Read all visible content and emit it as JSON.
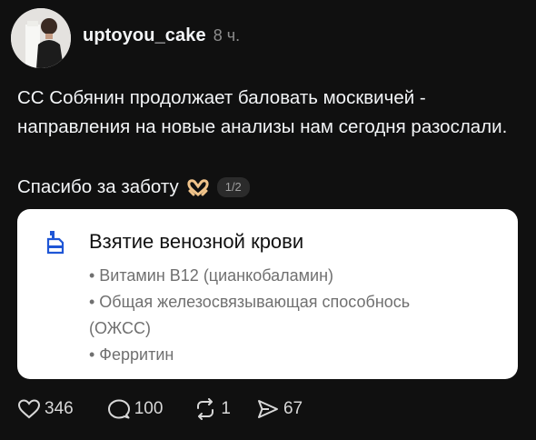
{
  "post": {
    "username": "uptoyou_cake",
    "time": "8 ч.",
    "text": "СС Собянин продолжает баловать москвичей - направления на новые анализы нам сегодня разослали.",
    "thanks": "Спасибо за заботу",
    "image_counter": "1/2"
  },
  "card": {
    "title": "Взятие венозной крови",
    "items": [
      "• Витамин B12 (цианкобаламин)",
      "• Общая железосвязывающая способнось (ОЖСС)",
      "• Ферритин"
    ]
  },
  "actions": {
    "likes": "346",
    "replies": "100",
    "reposts": "1",
    "shares": "67"
  },
  "icons": [
    "heart-icon",
    "comment-icon",
    "repost-icon",
    "share-icon",
    "heart-hands-emoji",
    "document-icon"
  ]
}
